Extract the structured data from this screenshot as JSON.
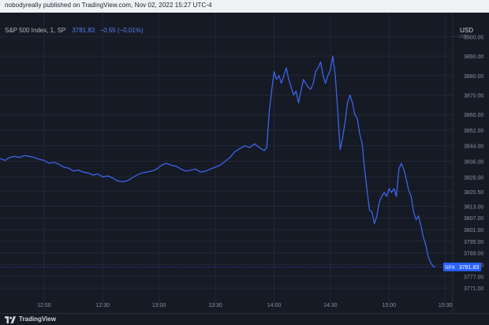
{
  "header": {
    "publisher_line": "nobodyreally published on TradingView.com, Nov 02, 2022 15:27 UTC-4"
  },
  "legend": {
    "title": "S&P 500 Index, 1, SP",
    "price": "3781.83",
    "change": "−0.55 (−0.01%)"
  },
  "axis": {
    "currency": "USD",
    "sub_currency": "— USD"
  },
  "footer": {
    "brand_name": "TradingView",
    "brand_icon": "tradingview-logo-icon"
  },
  "colors": {
    "background": "#161a25",
    "line": "#3d63e8",
    "last_price_tag": "#2962ff",
    "grid": "#232735",
    "axis_text": "#8c91a0"
  },
  "chart_data": {
    "type": "line",
    "title": "S&P 500 Index, 1, SP",
    "xlabel": "",
    "ylabel": "",
    "x_ticks": [
      "12:00",
      "12:30",
      "13:00",
      "13:30",
      "14:00",
      "14:30",
      "15:00",
      "15:30"
    ],
    "y_ticks": [
      "3900.00",
      "3890.00",
      "3880.00",
      "3870.00",
      "3860.00",
      "3852.00",
      "3844.00",
      "3836.00",
      "3828.00",
      "3820.50",
      "3813.00",
      "3807.00",
      "3801.00",
      "3795.00",
      "3789.00",
      "3783.00",
      "3777.00",
      "3771.00"
    ],
    "last_price_label": {
      "symbol": "SPX",
      "value": "3781.83"
    },
    "grid": true,
    "series": [
      {
        "values": [
          [
            0,
            3837.5
          ],
          [
            2,
            3836.5
          ],
          [
            4,
            3838
          ],
          [
            6,
            3838.5
          ],
          [
            8,
            3838
          ],
          [
            10,
            3839
          ],
          [
            12,
            3838.5
          ],
          [
            14,
            3838
          ],
          [
            16,
            3837
          ],
          [
            18,
            3836.5
          ],
          [
            20,
            3835
          ],
          [
            22,
            3835.5
          ],
          [
            24,
            3834.5
          ],
          [
            26,
            3833
          ],
          [
            28,
            3832.5
          ],
          [
            30,
            3831
          ],
          [
            32,
            3831.5
          ],
          [
            34,
            3830.5
          ],
          [
            36,
            3830
          ],
          [
            38,
            3829
          ],
          [
            40,
            3829.5
          ],
          [
            42,
            3828
          ],
          [
            44,
            3828.5
          ],
          [
            46,
            3827.5
          ],
          [
            48,
            3826
          ],
          [
            50,
            3825.5
          ],
          [
            52,
            3826
          ],
          [
            54,
            3827.5
          ],
          [
            56,
            3829
          ],
          [
            58,
            3830
          ],
          [
            60,
            3830.5
          ],
          [
            62,
            3831
          ],
          [
            64,
            3832
          ],
          [
            66,
            3834
          ],
          [
            68,
            3835
          ],
          [
            70,
            3834
          ],
          [
            72,
            3833.5
          ],
          [
            74,
            3832
          ],
          [
            76,
            3831
          ],
          [
            78,
            3831.5
          ],
          [
            80,
            3832
          ],
          [
            82,
            3830.5
          ],
          [
            84,
            3831
          ],
          [
            86,
            3832
          ],
          [
            88,
            3833
          ],
          [
            90,
            3834
          ],
          [
            92,
            3836
          ],
          [
            94,
            3838
          ],
          [
            96,
            3841
          ],
          [
            98,
            3842.5
          ],
          [
            100,
            3844
          ],
          [
            102,
            3843
          ],
          [
            104,
            3845
          ],
          [
            106,
            3843
          ],
          [
            108,
            3841.5
          ],
          [
            109,
            3843
          ],
          [
            110,
            3861
          ],
          [
            111,
            3872
          ],
          [
            112,
            3882
          ],
          [
            113,
            3878
          ],
          [
            114,
            3880
          ],
          [
            115,
            3876
          ],
          [
            116,
            3880
          ],
          [
            117,
            3884
          ],
          [
            118,
            3878
          ],
          [
            119,
            3874
          ],
          [
            120,
            3870
          ],
          [
            121,
            3872
          ],
          [
            122,
            3866
          ],
          [
            123,
            3872
          ],
          [
            124,
            3878
          ],
          [
            125,
            3876
          ],
          [
            126,
            3874
          ],
          [
            127,
            3873
          ],
          [
            128,
            3876
          ],
          [
            129,
            3882
          ],
          [
            130,
            3884
          ],
          [
            131,
            3887
          ],
          [
            132,
            3880
          ],
          [
            133,
            3876
          ],
          [
            134,
            3880
          ],
          [
            135,
            3883
          ],
          [
            136,
            3890
          ],
          [
            137,
            3880
          ],
          [
            138,
            3862
          ],
          [
            139,
            3842
          ],
          [
            140,
            3848
          ],
          [
            141,
            3856
          ],
          [
            142,
            3866
          ],
          [
            143,
            3870
          ],
          [
            144,
            3866
          ],
          [
            145,
            3860
          ],
          [
            146,
            3858
          ],
          [
            147,
            3850
          ],
          [
            148,
            3845
          ],
          [
            149,
            3832
          ],
          [
            150,
            3821
          ],
          [
            151,
            3811
          ],
          [
            152,
            3810
          ],
          [
            153,
            3804
          ],
          [
            154,
            3808
          ],
          [
            155,
            3815
          ],
          [
            156,
            3818
          ],
          [
            157,
            3820
          ],
          [
            158,
            3818
          ],
          [
            159,
            3822
          ],
          [
            160,
            3820
          ],
          [
            161,
            3822
          ],
          [
            162,
            3818
          ],
          [
            163,
            3832
          ],
          [
            164,
            3835
          ],
          [
            165,
            3832
          ],
          [
            166,
            3827
          ],
          [
            167,
            3821
          ],
          [
            168,
            3818
          ],
          [
            169,
            3810
          ],
          [
            170,
            3806
          ],
          [
            171,
            3808
          ],
          [
            172,
            3803
          ],
          [
            173,
            3797
          ],
          [
            174,
            3793
          ],
          [
            175,
            3787
          ],
          [
            176,
            3784
          ],
          [
            177,
            3782
          ],
          [
            178,
            3781.83
          ]
        ]
      }
    ]
  }
}
